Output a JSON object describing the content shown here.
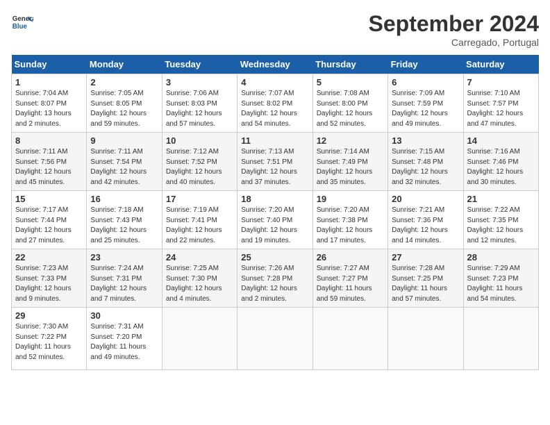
{
  "header": {
    "logo_line1": "General",
    "logo_line2": "Blue",
    "month_title": "September 2024",
    "location": "Carregado, Portugal"
  },
  "weekdays": [
    "Sunday",
    "Monday",
    "Tuesday",
    "Wednesday",
    "Thursday",
    "Friday",
    "Saturday"
  ],
  "weeks": [
    [
      {
        "day": "1",
        "info": "Sunrise: 7:04 AM\nSunset: 8:07 PM\nDaylight: 13 hours\nand 2 minutes."
      },
      {
        "day": "2",
        "info": "Sunrise: 7:05 AM\nSunset: 8:05 PM\nDaylight: 12 hours\nand 59 minutes."
      },
      {
        "day": "3",
        "info": "Sunrise: 7:06 AM\nSunset: 8:03 PM\nDaylight: 12 hours\nand 57 minutes."
      },
      {
        "day": "4",
        "info": "Sunrise: 7:07 AM\nSunset: 8:02 PM\nDaylight: 12 hours\nand 54 minutes."
      },
      {
        "day": "5",
        "info": "Sunrise: 7:08 AM\nSunset: 8:00 PM\nDaylight: 12 hours\nand 52 minutes."
      },
      {
        "day": "6",
        "info": "Sunrise: 7:09 AM\nSunset: 7:59 PM\nDaylight: 12 hours\nand 49 minutes."
      },
      {
        "day": "7",
        "info": "Sunrise: 7:10 AM\nSunset: 7:57 PM\nDaylight: 12 hours\nand 47 minutes."
      }
    ],
    [
      {
        "day": "8",
        "info": "Sunrise: 7:11 AM\nSunset: 7:56 PM\nDaylight: 12 hours\nand 45 minutes."
      },
      {
        "day": "9",
        "info": "Sunrise: 7:11 AM\nSunset: 7:54 PM\nDaylight: 12 hours\nand 42 minutes."
      },
      {
        "day": "10",
        "info": "Sunrise: 7:12 AM\nSunset: 7:52 PM\nDaylight: 12 hours\nand 40 minutes."
      },
      {
        "day": "11",
        "info": "Sunrise: 7:13 AM\nSunset: 7:51 PM\nDaylight: 12 hours\nand 37 minutes."
      },
      {
        "day": "12",
        "info": "Sunrise: 7:14 AM\nSunset: 7:49 PM\nDaylight: 12 hours\nand 35 minutes."
      },
      {
        "day": "13",
        "info": "Sunrise: 7:15 AM\nSunset: 7:48 PM\nDaylight: 12 hours\nand 32 minutes."
      },
      {
        "day": "14",
        "info": "Sunrise: 7:16 AM\nSunset: 7:46 PM\nDaylight: 12 hours\nand 30 minutes."
      }
    ],
    [
      {
        "day": "15",
        "info": "Sunrise: 7:17 AM\nSunset: 7:44 PM\nDaylight: 12 hours\nand 27 minutes."
      },
      {
        "day": "16",
        "info": "Sunrise: 7:18 AM\nSunset: 7:43 PM\nDaylight: 12 hours\nand 25 minutes."
      },
      {
        "day": "17",
        "info": "Sunrise: 7:19 AM\nSunset: 7:41 PM\nDaylight: 12 hours\nand 22 minutes."
      },
      {
        "day": "18",
        "info": "Sunrise: 7:20 AM\nSunset: 7:40 PM\nDaylight: 12 hours\nand 19 minutes."
      },
      {
        "day": "19",
        "info": "Sunrise: 7:20 AM\nSunset: 7:38 PM\nDaylight: 12 hours\nand 17 minutes."
      },
      {
        "day": "20",
        "info": "Sunrise: 7:21 AM\nSunset: 7:36 PM\nDaylight: 12 hours\nand 14 minutes."
      },
      {
        "day": "21",
        "info": "Sunrise: 7:22 AM\nSunset: 7:35 PM\nDaylight: 12 hours\nand 12 minutes."
      }
    ],
    [
      {
        "day": "22",
        "info": "Sunrise: 7:23 AM\nSunset: 7:33 PM\nDaylight: 12 hours\nand 9 minutes."
      },
      {
        "day": "23",
        "info": "Sunrise: 7:24 AM\nSunset: 7:31 PM\nDaylight: 12 hours\nand 7 minutes."
      },
      {
        "day": "24",
        "info": "Sunrise: 7:25 AM\nSunset: 7:30 PM\nDaylight: 12 hours\nand 4 minutes."
      },
      {
        "day": "25",
        "info": "Sunrise: 7:26 AM\nSunset: 7:28 PM\nDaylight: 12 hours\nand 2 minutes."
      },
      {
        "day": "26",
        "info": "Sunrise: 7:27 AM\nSunset: 7:27 PM\nDaylight: 11 hours\nand 59 minutes."
      },
      {
        "day": "27",
        "info": "Sunrise: 7:28 AM\nSunset: 7:25 PM\nDaylight: 11 hours\nand 57 minutes."
      },
      {
        "day": "28",
        "info": "Sunrise: 7:29 AM\nSunset: 7:23 PM\nDaylight: 11 hours\nand 54 minutes."
      }
    ],
    [
      {
        "day": "29",
        "info": "Sunrise: 7:30 AM\nSunset: 7:22 PM\nDaylight: 11 hours\nand 52 minutes."
      },
      {
        "day": "30",
        "info": "Sunrise: 7:31 AM\nSunset: 7:20 PM\nDaylight: 11 hours\nand 49 minutes."
      },
      {
        "day": "",
        "info": ""
      },
      {
        "day": "",
        "info": ""
      },
      {
        "day": "",
        "info": ""
      },
      {
        "day": "",
        "info": ""
      },
      {
        "day": "",
        "info": ""
      }
    ]
  ]
}
